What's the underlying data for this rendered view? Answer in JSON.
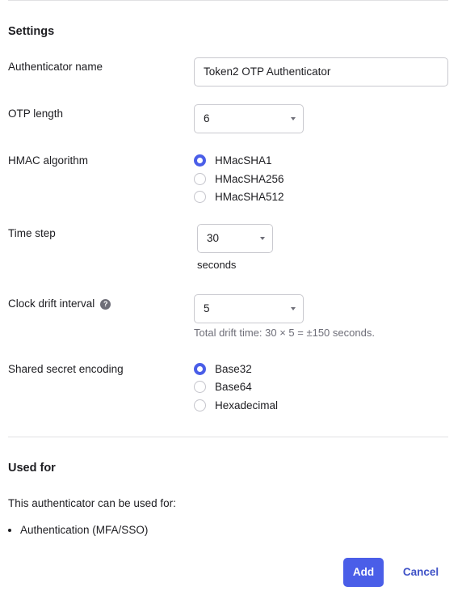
{
  "settings": {
    "title": "Settings",
    "authenticator_name": {
      "label": "Authenticator name",
      "value": "Token2 OTP Authenticator"
    },
    "otp_length": {
      "label": "OTP length",
      "value": "6"
    },
    "hmac": {
      "label": "HMAC algorithm",
      "options": [
        "HMacSHA1",
        "HMacSHA256",
        "HMacSHA512"
      ],
      "selected": "HMacSHA1"
    },
    "time_step": {
      "label": "Time step",
      "value": "30",
      "unit": "seconds"
    },
    "clock_drift": {
      "label": "Clock drift interval",
      "help_icon": "?",
      "value": "5",
      "hint": "Total drift time: 30 × 5 = ±150 seconds."
    },
    "encoding": {
      "label": "Shared secret encoding",
      "options": [
        "Base32",
        "Base64",
        "Hexadecimal"
      ],
      "selected": "Base32"
    }
  },
  "used_for": {
    "title": "Used for",
    "description": "This authenticator can be used for:",
    "items": [
      "Authentication (MFA/SSO)"
    ]
  },
  "actions": {
    "add": "Add",
    "cancel": "Cancel"
  },
  "colors": {
    "accent": "#4a5ee8",
    "link": "#3f52c7",
    "text": "#1d1d21",
    "muted": "#6e6e78",
    "border": "#c9c9cf"
  }
}
